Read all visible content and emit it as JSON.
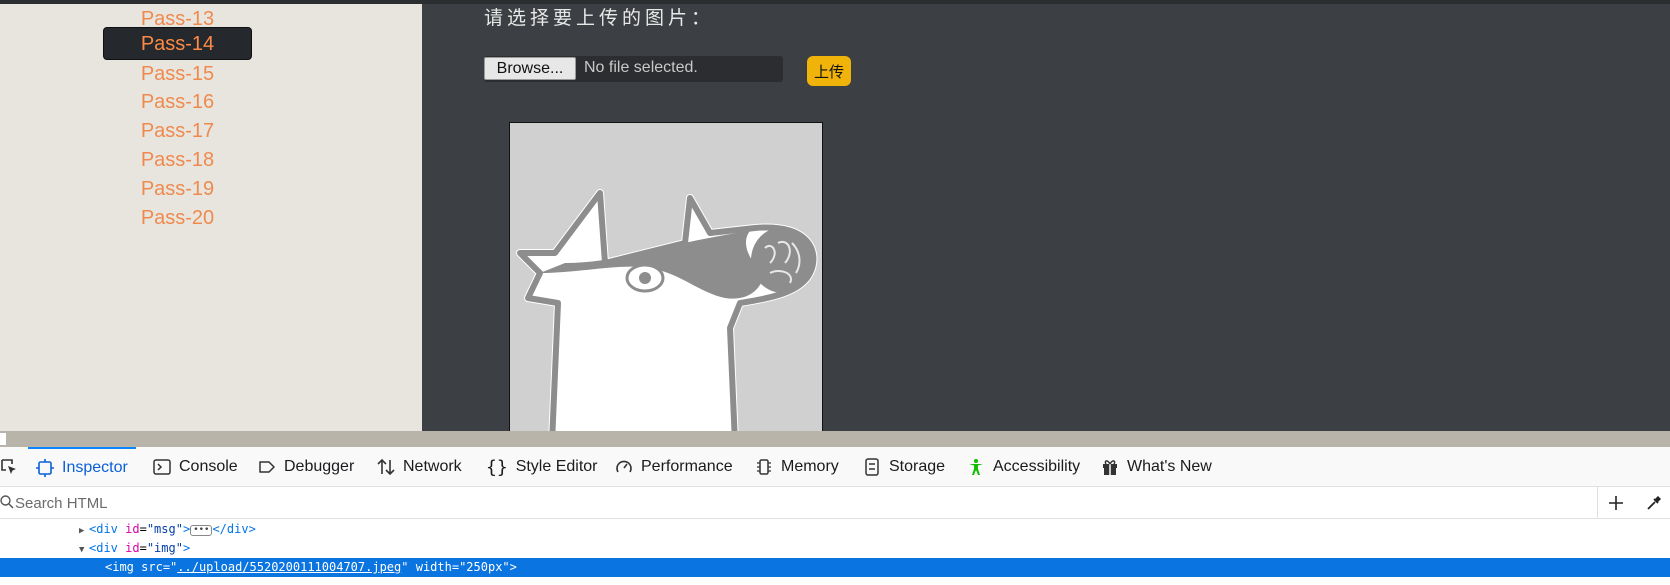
{
  "sidebar": {
    "items": [
      {
        "label": "Pass-13",
        "active": false
      },
      {
        "label": "Pass-14",
        "active": true
      },
      {
        "label": "Pass-15",
        "active": false
      },
      {
        "label": "Pass-16",
        "active": false
      },
      {
        "label": "Pass-17",
        "active": false
      },
      {
        "label": "Pass-18",
        "active": false
      },
      {
        "label": "Pass-19",
        "active": false
      },
      {
        "label": "Pass-20",
        "active": false
      }
    ]
  },
  "main": {
    "prompt": "请选择要上传的图片：",
    "browse_label": "Browse...",
    "file_status": "No file selected.",
    "upload_label": "上传"
  },
  "devtools": {
    "tabs": [
      {
        "label": "Inspector",
        "icon": "inspector-icon",
        "active": true
      },
      {
        "label": "Console",
        "icon": "console-icon"
      },
      {
        "label": "Debugger",
        "icon": "debugger-icon"
      },
      {
        "label": "Network",
        "icon": "network-icon"
      },
      {
        "label": "Style Editor",
        "icon": "style-editor-icon"
      },
      {
        "label": "Performance",
        "icon": "performance-icon"
      },
      {
        "label": "Memory",
        "icon": "memory-icon"
      },
      {
        "label": "Storage",
        "icon": "storage-icon"
      },
      {
        "label": "Accessibility",
        "icon": "accessibility-icon"
      },
      {
        "label": "What's New",
        "icon": "gift-icon"
      }
    ],
    "search_placeholder": "Search HTML",
    "markup": {
      "line1": {
        "tag_open": "<div",
        "attr": "id",
        "value": "\"msg\"",
        "close": ">",
        "end": "</div>"
      },
      "line2": {
        "tag_open": "<div",
        "attr": "id",
        "value": "\"img\"",
        "close": ">"
      },
      "line3": {
        "tag_open": "<img",
        "attr1": "src",
        "value1_pre": "=\"",
        "link": "../upload/5520200111004707.jpeg",
        "value1_post": "\"",
        "attr2": "width",
        "value2": "=\"250px\"",
        "close": ">"
      }
    }
  },
  "colors": {
    "sidebar_bg": "#e8e5df",
    "nav_text": "#ef8a4e",
    "main_bg": "#3c3f43",
    "upload_btn": "#f0b30a",
    "devtools_accent": "#0a84ff",
    "selection": "#0a74e0"
  }
}
